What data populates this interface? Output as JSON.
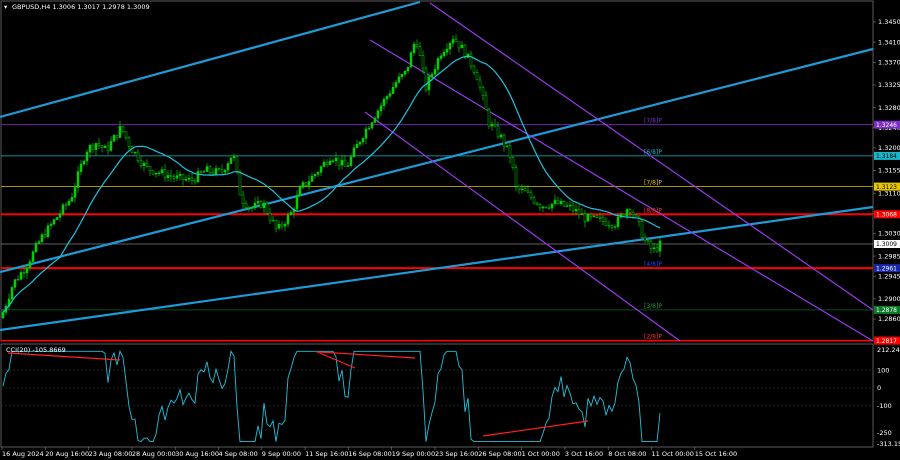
{
  "title": "GBPUSD,H4  1.3006 1.3017 1.2978 1.3009",
  "indicator_label": "CCI(20) -105.8669",
  "colors": {
    "background": "#000000",
    "candles": "#00d000",
    "ma": "#22c1dd",
    "trend": "#1e9bd7",
    "channel": "#9b39f0",
    "level_red": "#ff0000",
    "cci": "#22c1dd",
    "divergence": "#ff2020"
  },
  "price_scale": [
    "1.3450",
    "1.3410",
    "1.3370",
    "1.3325",
    "1.3280",
    "1.3240",
    "1.3200",
    "1.3155",
    "1.3110",
    "1.3070",
    "1.3030",
    "1.2985",
    "1.2945",
    "1.2900",
    "1.2860"
  ],
  "right_tags": [
    {
      "text": "1.3246",
      "bg": "#7a2ec2",
      "fg": "#ffffff",
      "price": 1.3246
    },
    {
      "text": "1.3184",
      "bg": "#18b7c9",
      "fg": "#000000",
      "price": 1.3184
    },
    {
      "text": "1.3123",
      "bg": "#e6c400",
      "fg": "#000000",
      "price": 1.3123
    },
    {
      "text": "1.3068",
      "bg": "#ff0000",
      "fg": "#ffffff",
      "price": 1.3068
    },
    {
      "text": "1.3009",
      "bg": "#ffffff",
      "fg": "#000000",
      "price": 1.3009
    },
    {
      "text": "1.2961",
      "bg": "#1a28a8",
      "fg": "#ffffff",
      "price": 1.2961
    },
    {
      "text": "1.2878",
      "bg": "#0d7a2a",
      "fg": "#ffffff",
      "price": 1.2878
    },
    {
      "text": "1.2817",
      "bg": "#ff0000",
      "fg": "#ffffff",
      "price": 1.2817
    }
  ],
  "murrey_labels": [
    {
      "text": "[7/8]P",
      "color": "#7a2ec2",
      "price": 1.3246
    },
    {
      "text": "[6/8]P",
      "color": "#18b7c9",
      "price": 1.3184
    },
    {
      "text": "[7/8]P",
      "color": "#e6c400",
      "price": 1.3123
    },
    {
      "text": "[8/8]P",
      "color": "#ff3030",
      "price": 1.3068
    },
    {
      "text": "[4/8]P",
      "color": "#2040ff",
      "price": 1.2961
    },
    {
      "text": "[3/8]P",
      "color": "#13a040",
      "price": 1.2878
    },
    {
      "text": "[2/8]P",
      "color": "#ff3030",
      "price": 1.2817
    }
  ],
  "cci_scale": [
    "212.2406",
    "100",
    "0",
    "-100",
    "-250",
    "-313.1516"
  ],
  "time_axis": [
    "16 Aug 2024",
    "20 Aug 16:00",
    "23 Aug 08:00",
    "28 Aug 00:00",
    "30 Aug 16:00",
    "4 Sep 08:00",
    "9 Sep 00:00",
    "11 Sep 16:00",
    "16 Sep 08:00",
    "19 Sep 00:00",
    "23 Sep 16:00",
    "26 Sep 08:00",
    "1 Oct 00:00",
    "3 Oct 16:00",
    "8 Oct 08:00",
    "11 Oct 00:00",
    "15 Oct 16:00"
  ]
}
